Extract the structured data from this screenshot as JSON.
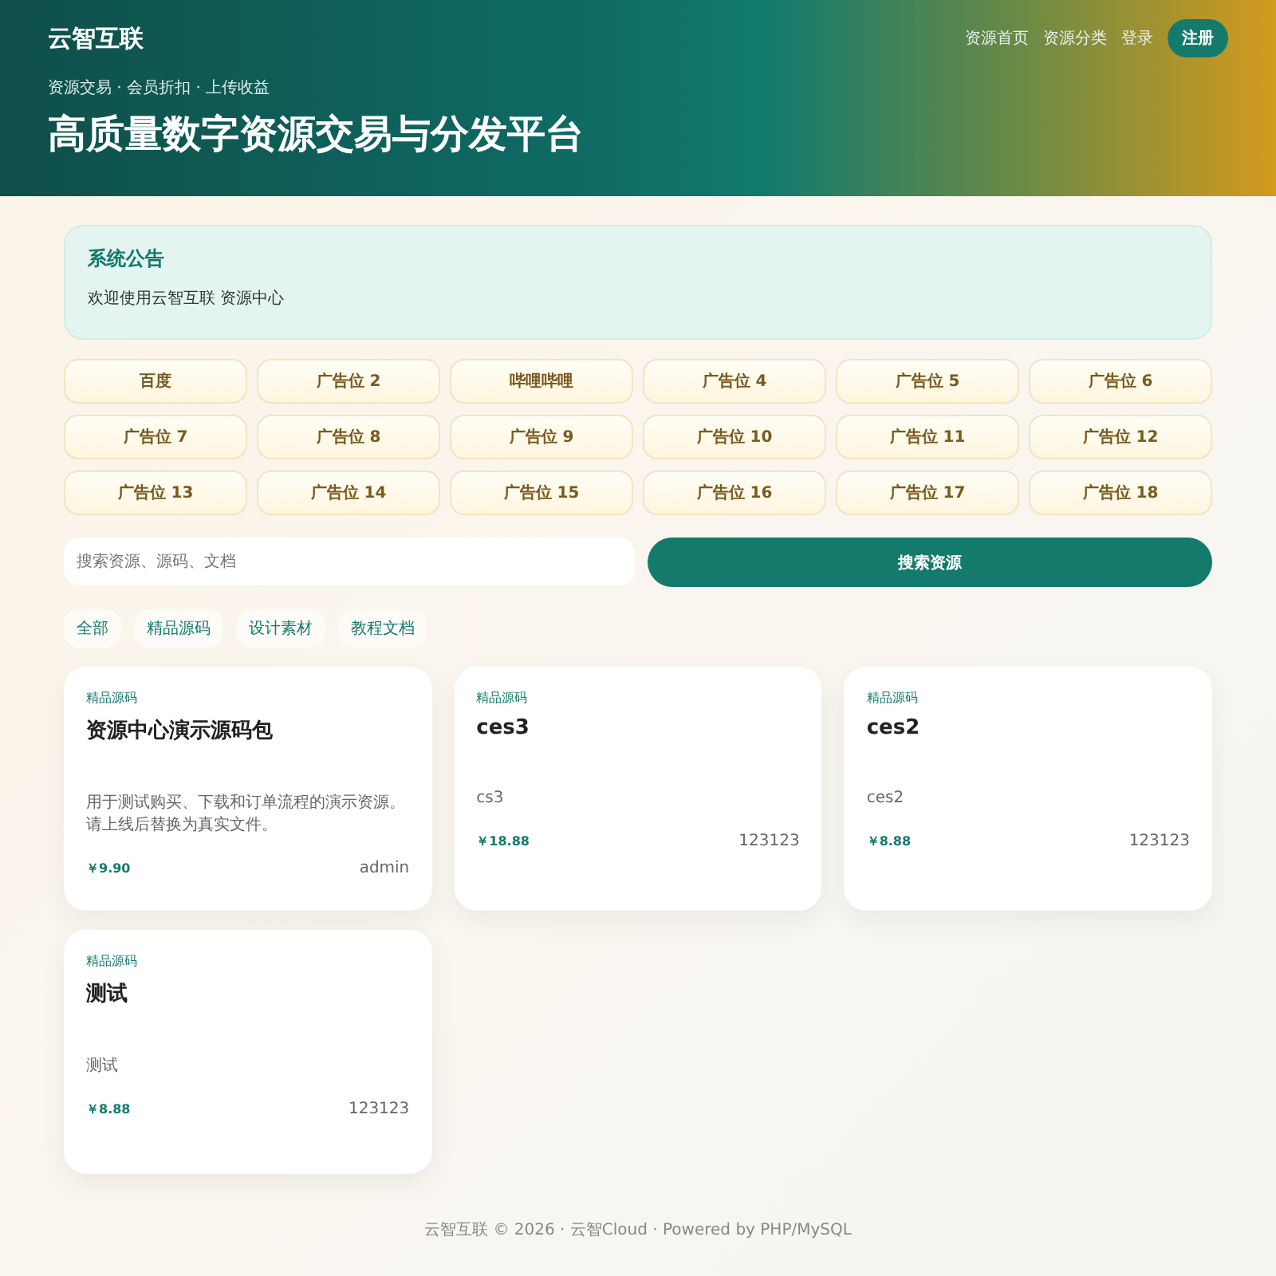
{
  "header": {
    "brand": "云智互联",
    "nav": [
      {
        "label": "资源首页"
      },
      {
        "label": "资源分类"
      },
      {
        "label": "登录"
      }
    ],
    "register_button": "注册",
    "tagline": "资源交易 · 会员折扣 · 上传收益",
    "headline": "高质量数字资源交易与分发平台"
  },
  "notice": {
    "title": "系统公告",
    "text": "欢迎使用云智互联 资源中心"
  },
  "ads": [
    "百度",
    "广告位 2",
    "哔哩哔哩",
    "广告位 4",
    "广告位 5",
    "广告位 6",
    "广告位 7",
    "广告位 8",
    "广告位 9",
    "广告位 10",
    "广告位 11",
    "广告位 12",
    "广告位 13",
    "广告位 14",
    "广告位 15",
    "广告位 16",
    "广告位 17",
    "广告位 18"
  ],
  "search": {
    "placeholder": "搜索资源、源码、文档",
    "button": "搜索资源"
  },
  "filters": [
    "全部",
    "精品源码",
    "设计素材",
    "教程文档"
  ],
  "resources": [
    {
      "category": "精品源码",
      "title": "资源中心演示源码包",
      "description": "用于测试购买、下载和订单流程的演示资源。请上线后替换为真实文件。",
      "price": "￥9.90",
      "author": "admin"
    },
    {
      "category": "精品源码",
      "title": "ces3",
      "description": "cs3",
      "price": "￥18.88",
      "author": "123123"
    },
    {
      "category": "精品源码",
      "title": "ces2",
      "description": "ces2",
      "price": "￥8.88",
      "author": "123123"
    },
    {
      "category": "精品源码",
      "title": "测试",
      "description": "测试",
      "price": "￥8.88",
      "author": "123123"
    }
  ],
  "footer": "云智互联 © 2026 · 云智Cloud · Powered by PHP/MySQL"
}
